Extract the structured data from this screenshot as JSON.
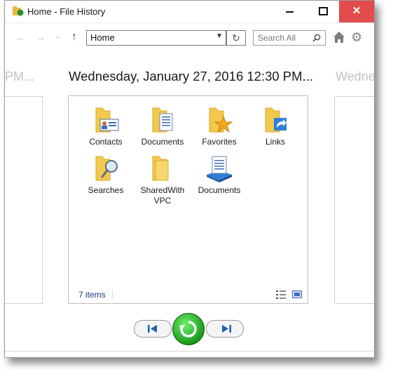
{
  "window": {
    "title": "Home - File History",
    "close_glyph": "✕"
  },
  "nav": {
    "back_glyph": "←",
    "forward_glyph": "→",
    "recent_glyph": "⌄",
    "up_glyph": "↑",
    "address": "Home",
    "refresh_glyph": "↻",
    "search_placeholder": "Search All"
  },
  "timeline": {
    "prev_label": "PM...",
    "current_label": "Wednesday, January 27, 2016 12:30 PM...",
    "next_label": "Wedne"
  },
  "items": [
    {
      "label": "Contacts",
      "icon": "contacts-folder-icon"
    },
    {
      "label": "Documents",
      "icon": "documents-folder-icon"
    },
    {
      "label": "Favorites",
      "icon": "favorites-folder-icon"
    },
    {
      "label": "Links",
      "icon": "links-folder-icon"
    },
    {
      "label": "Searches",
      "icon": "searches-folder-icon"
    },
    {
      "label": "SharedWith VPC",
      "icon": "folder-icon"
    },
    {
      "label": "Documents",
      "icon": "documents-library-icon"
    }
  ],
  "status": {
    "count": "7 items"
  },
  "colors": {
    "close_button": "#e24b4b",
    "folder_yellow": "#f2c94c",
    "restore_green": "#1c9a1c",
    "status_text": "#1a3c75"
  }
}
